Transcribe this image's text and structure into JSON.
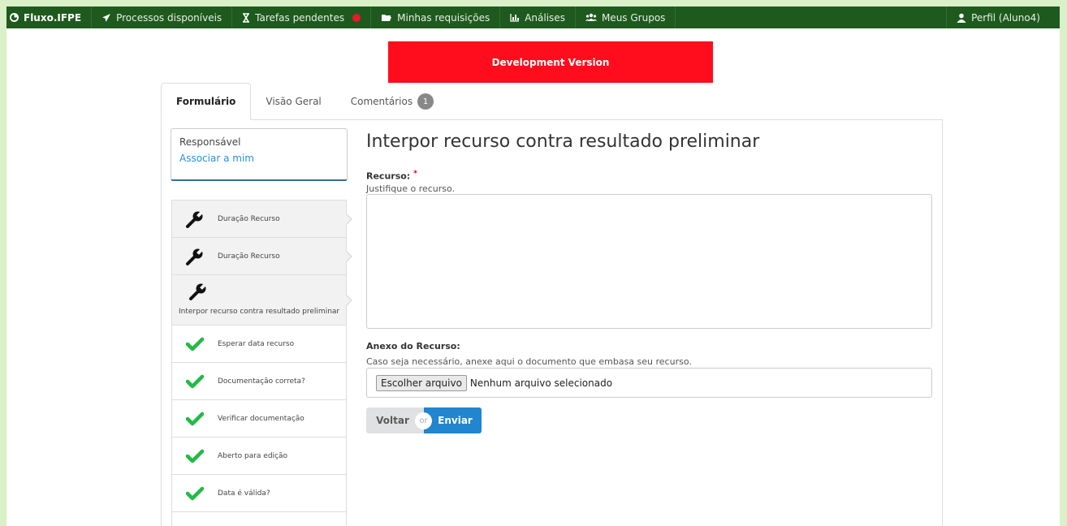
{
  "navbar": {
    "brand": "Fluxo.IFPE",
    "items": [
      {
        "label": "Processos disponíveis",
        "icon": "paper-plane-icon"
      },
      {
        "label": "Tarefas pendentes",
        "icon": "hourglass-icon"
      },
      {
        "label": "Minhas requisições",
        "icon": "folder-open-icon"
      },
      {
        "label": "Análises",
        "icon": "bar-chart-icon"
      },
      {
        "label": "Meus Grupos",
        "icon": "users-icon"
      }
    ],
    "profile": "Perfil (Aluno4)"
  },
  "banner": {
    "text": "Development Version",
    "color": "#ff0d1c"
  },
  "tabs": [
    {
      "label": "Formulário",
      "active": true
    },
    {
      "label": "Visão Geral",
      "active": false
    },
    {
      "label": "Comentários",
      "active": false,
      "badge": "1"
    }
  ],
  "sidebar": {
    "responsavel_label": "Responsável",
    "assign_link": "Associar a mim",
    "steps": [
      {
        "label": "Duração Recurso",
        "icon": "wrench-icon",
        "status": "active"
      },
      {
        "label": "Duração Recurso",
        "icon": "wrench-icon",
        "status": "active"
      },
      {
        "label": "Interpor recurso contra resultado preliminar",
        "icon": "wrench-icon",
        "status": "active"
      },
      {
        "label": "Esperar data recurso",
        "icon": "check-icon",
        "status": "done"
      },
      {
        "label": "Documentação correta?",
        "icon": "check-icon",
        "status": "done"
      },
      {
        "label": "Verificar documentação",
        "icon": "check-icon",
        "status": "done"
      },
      {
        "label": "Aberto para edição",
        "icon": "check-icon",
        "status": "done"
      },
      {
        "label": "Data é válida?",
        "icon": "check-icon",
        "status": "done"
      }
    ]
  },
  "form": {
    "title": "Interpor recurso contra resultado preliminar",
    "recurso_label": "Recurso:",
    "recurso_required": "*",
    "recurso_help": "Justifique o recurso.",
    "recurso_value": "",
    "anexo_label": "Anexo do Recurso:",
    "anexo_help": "Caso seja necessário, anexe aqui o documento que embasa seu recurso.",
    "file_button": "Escolher arquivo",
    "file_status": "Nenhum arquivo selecionado",
    "back_button": "Voltar",
    "or_text": "or",
    "submit_button": "Enviar"
  },
  "colors": {
    "navbar": "#1e5a1e",
    "accent": "#2185d0",
    "check": "#21ba45"
  }
}
